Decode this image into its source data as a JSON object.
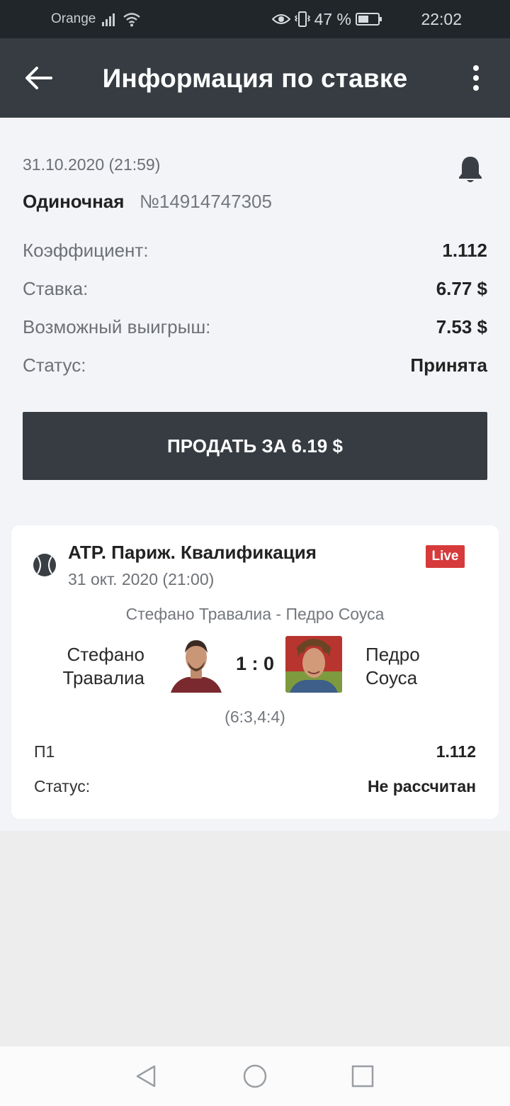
{
  "status_bar": {
    "carrier": "Orange",
    "battery_percent": "47 %",
    "time": "22:02",
    "icons": [
      "signal-icon",
      "wifi-icon",
      "eye-icon",
      "vibrate-icon",
      "battery-icon"
    ]
  },
  "app_bar": {
    "title": "Информация по ставке",
    "back_icon": "arrow-left-icon",
    "menu_icon": "more-vert-icon"
  },
  "bet": {
    "date": "31.10.2020 (21:59)",
    "type": "Одиночная",
    "number": "№14914747305",
    "bell_icon": "bell-icon",
    "rows": [
      {
        "label": "Коэффициент:",
        "value": "1.112"
      },
      {
        "label": "Ставка:",
        "value": "6.77 $"
      },
      {
        "label": "Возможный выигрыш:",
        "value": "7.53 $"
      },
      {
        "label": "Статус:",
        "value": "Принята"
      }
    ],
    "sell_label": "ПРОДАТЬ ЗА 6.19 $"
  },
  "event": {
    "sport_icon": "tennis-ball-icon",
    "league": "ATP. Париж. Квалификация",
    "date": "31 окт. 2020 (21:00)",
    "live_label": "Live",
    "match_title": "Стефано Травалиа - Педро Соуса",
    "team1_line1": "Стефано",
    "team1_line2": "Травалиа",
    "team2_line1": "Педро",
    "team2_line2": "Соуса",
    "score": "1 : 0",
    "sets": "(6:3,4:4)",
    "rows": [
      {
        "label": "П1",
        "value": "1.112"
      },
      {
        "label": "Статус:",
        "value": "Не рассчитан"
      }
    ]
  },
  "colors": {
    "app_bar": "#363c42",
    "status_bar": "#21262b",
    "background": "#f3f4f8",
    "live_badge": "#d63a3a"
  }
}
